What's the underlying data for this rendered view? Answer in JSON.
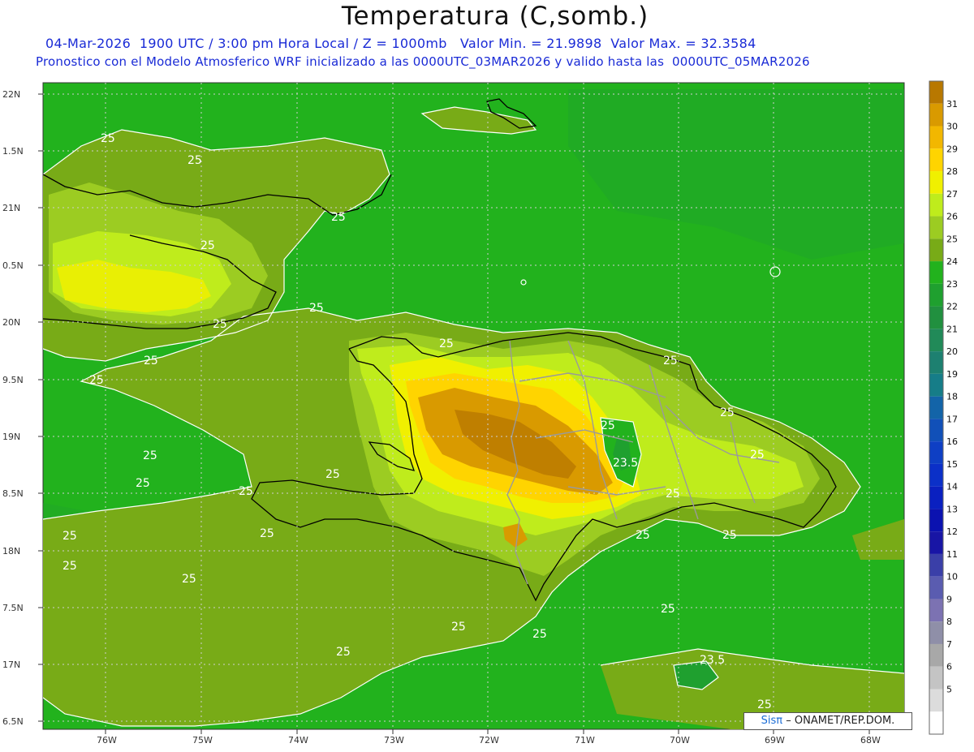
{
  "header": {
    "title": "Temperatura (C,somb.)",
    "line1": "04-Mar-2026  1900 UTC / 3:00 pm Hora Local / Z = 1000mb   Valor Min. = 21.9898  Valor Max. = 32.3584",
    "line2": "Pronostico con el Modelo Atmosferico WRF inicializado a las 0000UTC_03MAR2026 y valido hasta las  0000UTC_05MAR2026"
  },
  "axes": {
    "lat_labels": [
      "22N",
      "1.5N",
      "21N",
      "0.5N",
      "20N",
      "9.5N",
      "19N",
      "8.5N",
      "18N",
      "7.5N",
      "17N",
      "6.5N"
    ],
    "lon_labels": [
      "76W",
      "75W",
      "74W",
      "73W",
      "72W",
      "71W",
      "70W",
      "69W",
      "68W"
    ]
  },
  "contour_labels": [
    "25",
    "25",
    "25",
    "25",
    "25",
    "25",
    "25",
    "25",
    "25",
    "25",
    "25",
    "25",
    "25",
    "25",
    "25",
    "25",
    "25",
    "25",
    "25",
    "25",
    "25",
    "25",
    "25",
    "25",
    "25",
    "23.5",
    "23.5"
  ],
  "legend": {
    "labels": [
      "31",
      "30",
      "29",
      "28",
      "27",
      "26",
      "25",
      "24",
      "23",
      "22",
      "21",
      "20",
      "19",
      "18",
      "17",
      "16",
      "15",
      "14",
      "13",
      "12",
      "11",
      "10",
      "9",
      "8",
      "7",
      "6",
      "5"
    ],
    "colors": [
      "#b87800",
      "#d99a00",
      "#f2b700",
      "#ffd400",
      "#f0f000",
      "#bfec1c",
      "#9ccc22",
      "#78ab17",
      "#22b21d",
      "#1fa02f",
      "#21903f",
      "#218a58",
      "#1d8070",
      "#167d88",
      "#1364a8",
      "#1150b8",
      "#0e3fc4",
      "#0b30c8",
      "#0a20c0",
      "#0b12b0",
      "#1815a5",
      "#3a3fa8",
      "#5a5cb0",
      "#7c72b2",
      "#8f8fa8",
      "#a8a8a8",
      "#c4c4c4",
      "#dcdcdc",
      "#ffffff"
    ]
  },
  "credit": {
    "sis": "Sisπ",
    "rest": "– ONAMET/REP.DOM."
  },
  "colors": {
    "sea": "#22b21d",
    "land25": "#78ab17",
    "land26": "#9ccc22",
    "land27": "#bfec1c",
    "land28": "#f0f000",
    "land29": "#ffd400",
    "land30": "#d99a00",
    "land31": "#b87800"
  }
}
